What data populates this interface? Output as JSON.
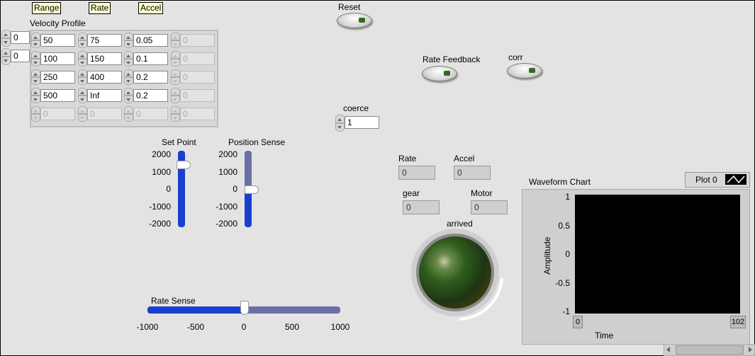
{
  "array_headers": {
    "range": "Range",
    "rate": "Rate",
    "accel": "Accel"
  },
  "velocity_profile": {
    "label": "Velocity Profile",
    "index_row": "0",
    "index_col": "0",
    "rows": [
      [
        "50",
        "75",
        "0.05",
        "0"
      ],
      [
        "100",
        "150",
        "0.1",
        "0"
      ],
      [
        "250",
        "400",
        "0.2",
        "0"
      ],
      [
        "500",
        "Inf",
        "0.2",
        "0"
      ],
      [
        "0",
        "0",
        "0",
        "0"
      ]
    ]
  },
  "buttons": {
    "reset": "Reset",
    "rate_feedback": "Rate Feedback",
    "corr": "corr"
  },
  "coerce": {
    "label": "coerce",
    "value": "1"
  },
  "set_point": {
    "label": "Set Point",
    "value_fraction": 0.85
  },
  "position_sense": {
    "label": "Position Sense",
    "value_fraction": 0.5
  },
  "vertical_scale": [
    "2000",
    "1000",
    "0",
    "-1000",
    "-2000"
  ],
  "indicators": {
    "rate": {
      "label": "Rate",
      "value": "0"
    },
    "accel": {
      "label": "Accel",
      "value": "0"
    },
    "gear": {
      "label": "gear",
      "value": "0"
    },
    "motor": {
      "label": "Motor",
      "value": "0"
    }
  },
  "arrived": {
    "label": "arrived"
  },
  "rate_sense": {
    "label": "Rate Sense",
    "value": 0,
    "scale": [
      "-1000",
      "-500",
      "0",
      "500",
      "1000"
    ]
  },
  "chart": {
    "title": "Waveform Chart",
    "legend": "Plot 0",
    "ylabel": "Amplitude",
    "xlabel": "Time",
    "yticks": [
      "1",
      "0.5",
      "0",
      "-0.5",
      "-1"
    ],
    "xmin": "0",
    "xmax": "102"
  },
  "colors": {
    "slider_fill": "#1a3fcf",
    "slider_track": "#6a6fa6",
    "led": "#2e6b1e",
    "plot_bg": "#000000"
  }
}
